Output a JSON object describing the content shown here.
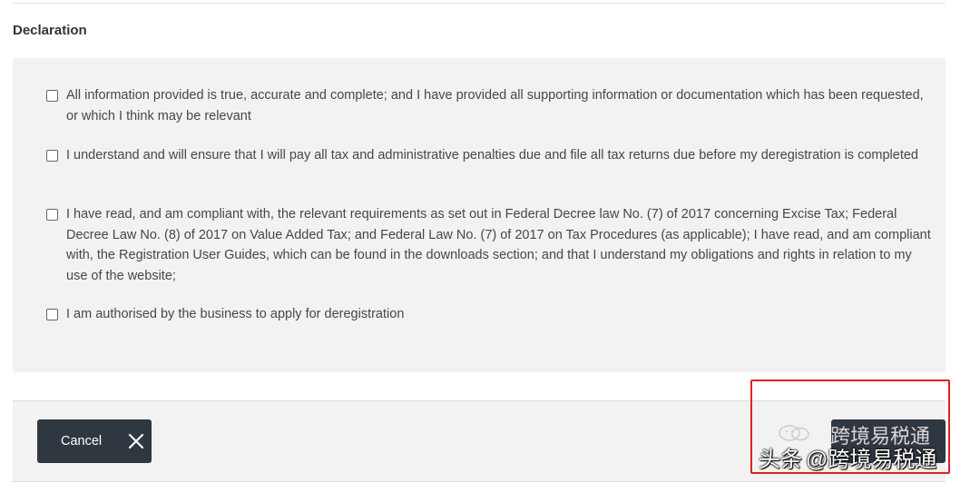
{
  "section": {
    "title": "Declaration"
  },
  "declarations": [
    {
      "text": "All information provided is true, accurate and complete; and I have provided all supporting information or documentation which has been requested, or which I think may be relevant"
    },
    {
      "text": "I understand and will ensure that I will pay all tax and administrative penalties due and file all tax returns due before my deregistration is completed"
    },
    {
      "text": "I have read, and am compliant with, the relevant requirements as set out in Federal Decree law No. (7) of 2017 concerning Excise Tax; Federal Decree Law No. (8) of 2017 on Value Added Tax; and Federal Law No. (7) of 2017 on Tax Procedures (as applicable); I have read, and am compliant with, the Registration User Guides, which can be found in the downloads section; and that I understand my obligations and rights in relation to my use of the website;"
    },
    {
      "text": "I am authorised by the business to apply for deregistration"
    }
  ],
  "footer": {
    "cancel_label": "Cancel",
    "cancel_icon": "close-icon"
  },
  "watermark": {
    "prefix": "头条",
    "handle": "@跨境易税通",
    "brand": "跨境易税通"
  },
  "colors": {
    "panel_background": "#f2f2f2",
    "button_background": "#2f3740",
    "annotation_border": "#e02020"
  }
}
